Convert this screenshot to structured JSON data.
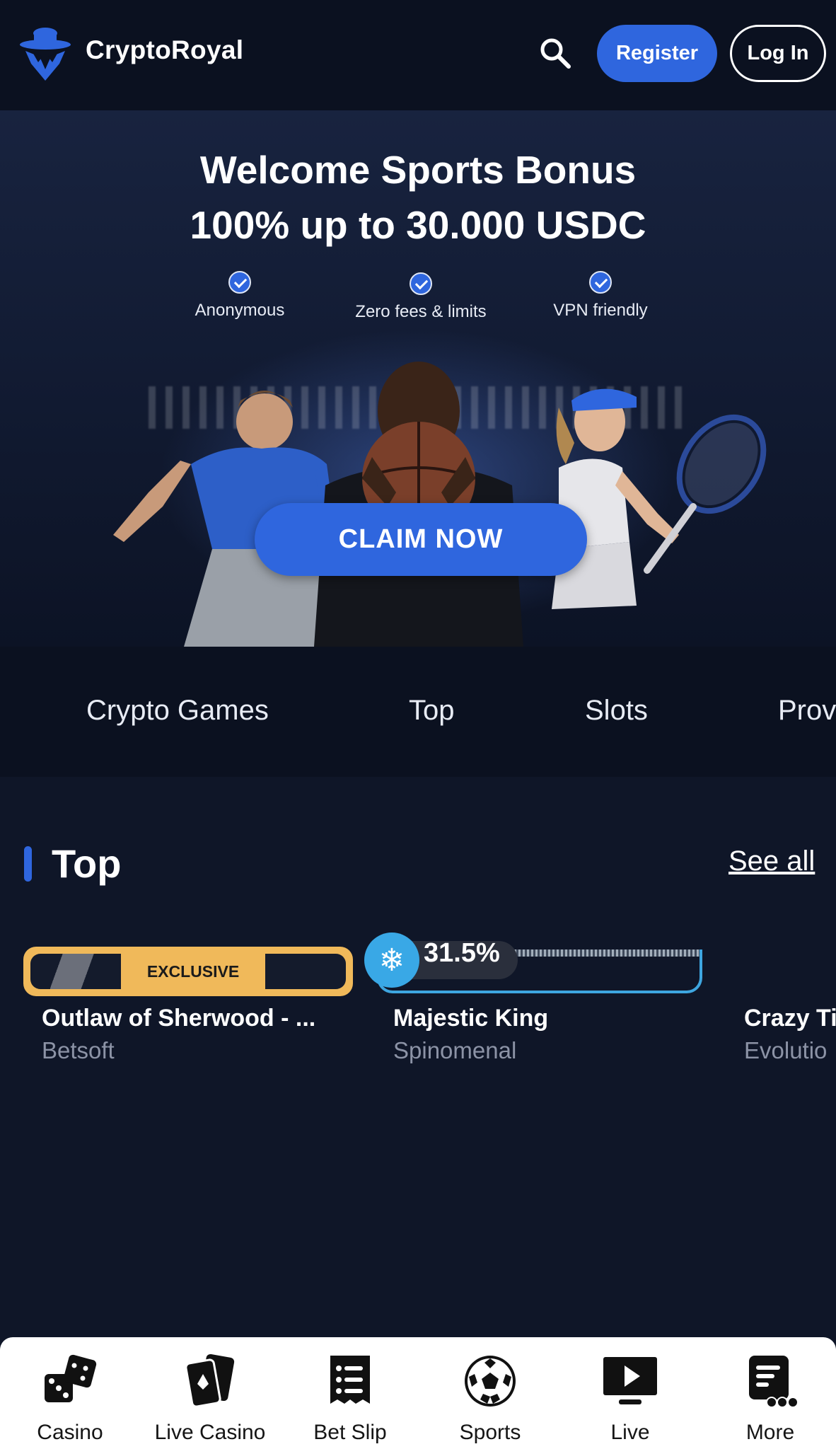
{
  "header": {
    "brand": "CryptoRoyal",
    "logo_icon": "spy-hat-logo-icon",
    "search_icon": "search-icon",
    "register_label": "Register",
    "login_label": "Log In"
  },
  "banner": {
    "title_line1": "Welcome Sports Bonus",
    "title_line2": "100% up to 30.000 USDC",
    "features": [
      {
        "label": "Anonymous",
        "icon": "check-circle-icon"
      },
      {
        "label": "Zero fees & limits",
        "icon": "check-circle-icon"
      },
      {
        "label": "VPN friendly",
        "icon": "check-circle-icon"
      }
    ],
    "cta_label": "CLAIM NOW"
  },
  "categories": [
    {
      "label": "Crypto Games"
    },
    {
      "label": "Top"
    },
    {
      "label": "Slots"
    },
    {
      "label": "Prov"
    }
  ],
  "section": {
    "title": "Top",
    "see_all": "See all"
  },
  "games": [
    {
      "name": "Outlaw of Sherwood - ...",
      "provider": "Betsoft",
      "badge": "EXCLUSIVE"
    },
    {
      "name": "Majestic King",
      "provider": "Spinomenal",
      "badge": "31.5%",
      "badge_icon": "snowflake-icon"
    },
    {
      "name": "Crazy Ti",
      "provider": "Evolutio"
    }
  ],
  "bottom_nav": [
    {
      "label": "Casino",
      "icon": "dice-icon"
    },
    {
      "label": "Live Casino",
      "icon": "playing-cards-icon"
    },
    {
      "label": "Bet Slip",
      "icon": "receipt-list-icon"
    },
    {
      "label": "Sports",
      "icon": "soccer-ball-icon"
    },
    {
      "label": "Live",
      "icon": "play-monitor-icon"
    },
    {
      "label": "More",
      "icon": "more-document-icon"
    }
  ],
  "colors": {
    "accent": "#2f66de",
    "background": "#0f1628",
    "header_bg": "#0b1120",
    "exclusive_gold": "#f0b95a",
    "frost_blue": "#39a8e6"
  }
}
